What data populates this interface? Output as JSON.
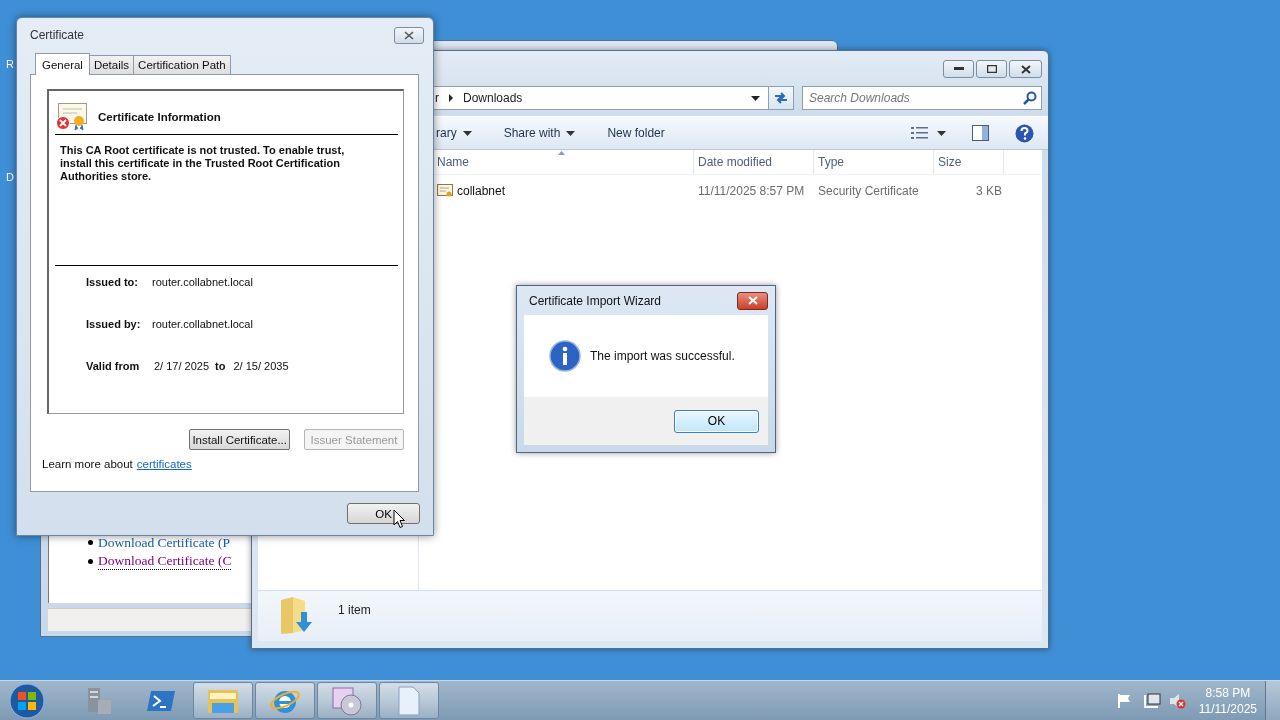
{
  "desktop": {
    "icon_labels": [
      "R",
      "D"
    ]
  },
  "browser": {
    "links": [
      {
        "label": "Download Certificate (P",
        "visited": false
      },
      {
        "label": "Download Certificate (C",
        "visited": true
      }
    ]
  },
  "explorer": {
    "breadcrumb": [
      "r",
      "Downloads"
    ],
    "search": {
      "placeholder": "Search Downloads"
    },
    "toolbar": [
      {
        "label": "rary",
        "dropdown": true
      },
      {
        "label": "Share with",
        "dropdown": true
      },
      {
        "label": "New folder",
        "dropdown": false
      }
    ],
    "columns": [
      {
        "label": "Name",
        "sorted": true
      },
      {
        "label": "Date modified",
        "sorted": false
      },
      {
        "label": "Type",
        "sorted": false
      },
      {
        "label": "Size",
        "sorted": false
      }
    ],
    "files": [
      {
        "name": "collabnet",
        "date": "11/11/2025 8:57 PM",
        "type": "Security Certificate",
        "size": "3 KB"
      }
    ],
    "status": "1 item"
  },
  "wizard": {
    "title": "Certificate Import Wizard",
    "message": "The import was successful.",
    "ok": "OK"
  },
  "certificate": {
    "title": "Certificate",
    "tabs": [
      {
        "label": "General",
        "selected": true
      },
      {
        "label": "Details",
        "selected": false
      },
      {
        "label": "Certification Path",
        "selected": false
      }
    ],
    "heading": "Certificate Information",
    "message": "This CA Root certificate is not trusted. To enable trust, install this certificate in the Trusted Root Certification Authorities store.",
    "fields": [
      {
        "label": "Issued to:",
        "value": "router.collabnet.local"
      },
      {
        "label": "Issued by:",
        "value": "router.collabnet.local"
      }
    ],
    "valid": {
      "label": "Valid from",
      "from": "2/ 17/ 2025",
      "to_label": "to",
      "to": "2/ 15/ 2035"
    },
    "buttons": [
      {
        "label": "Install Certificate...",
        "disabled": false
      },
      {
        "label": "Issuer Statement",
        "disabled": true
      }
    ],
    "learn_more": {
      "text": "Learn more about",
      "link": "certificates"
    },
    "ok": "OK"
  },
  "taskbar": {
    "time": "8:58 PM",
    "date": "11/11/2025"
  }
}
